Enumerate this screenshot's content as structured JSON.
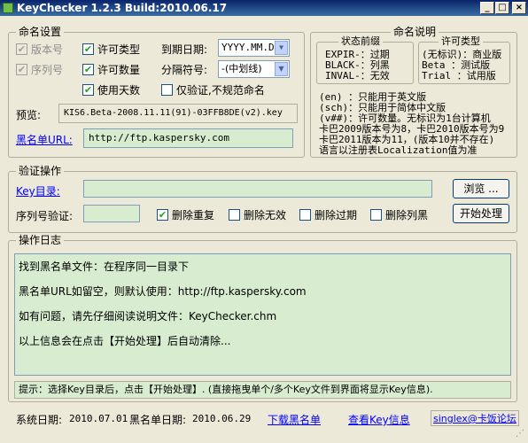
{
  "window": {
    "title": "KeyChecker 1.2.3 Build:2010.06.17"
  },
  "naming": {
    "legend": "命名设置",
    "version_label": "版本号",
    "serial_label": "序列号",
    "license_type_label": "许可类型",
    "license_count_label": "许可数量",
    "use_days_label": "使用天数",
    "expiry_label": "到期日期:",
    "expiry_value": "YYYY.MM.DD",
    "separator_label": "分隔符号:",
    "separator_value": "-(中划线)",
    "verify_only_label": "仅验证,不规范命名",
    "preview_label": "预览:",
    "preview_value": "KIS6.Beta-2008.11.11(91)-03FFB8DE(v2).key",
    "blacklist_label": "黑名单URL:",
    "blacklist_value": "http://ftp.kaspersky.com"
  },
  "naming_help": {
    "legend": "命名说明",
    "status_title": "状态前缀",
    "status_rows": [
      "EXPIR-：过期",
      "BLACK-：列黑",
      "INVAL-：无效"
    ],
    "license_title": "许可类型",
    "license_rows": [
      "(无标识)：商业版",
      "Beta  ：测试版",
      "Trial ：试用版"
    ],
    "notes": [
      "(en) ：只能用于英文版",
      "(sch)：只能用于简体中文版",
      "(v##)：许可数量。无标识为1台计算机",
      "卡巴2009版本号为8，卡巴2010版本号为9",
      "卡巴2011版本为11，(版本10并不存在)",
      "语言以注册表Localization值为准"
    ]
  },
  "verify": {
    "legend": "验证操作",
    "key_dir_label": "Key目录:",
    "browse_button": "浏览 ...",
    "serial_verify_label": "序列号验证:",
    "del_dup_label": "删除重复",
    "del_invalid_label": "删除无效",
    "del_expired_label": "删除过期",
    "del_black_label": "删除列黑",
    "start_button": "开始处理"
  },
  "log": {
    "legend": "操作日志",
    "lines": [
      "找到黑名单文件：在程序同一目录下",
      "黑名单URL如留空，则默认使用：http://ftp.kaspersky.com",
      "如有问题，请先仔细阅读说明文件：KeyChecker.chm",
      "以上信息会在点击【开始处理】后自动清除..."
    ],
    "hint": "提示：选择Key目录后，点击【开始处理】. (直接拖曳单个/多个Key文件到界面将显示Key信息)."
  },
  "status": {
    "system_date_label": "系统日期:",
    "system_date_value": "2010.07.01",
    "blacklist_date_label": "黑名单日期:",
    "blacklist_date_value": "2010.06.29",
    "download_link": "下载黑名单",
    "view_key_link": "查看Key信息",
    "forum_link": "singlex@卡饭论坛"
  }
}
